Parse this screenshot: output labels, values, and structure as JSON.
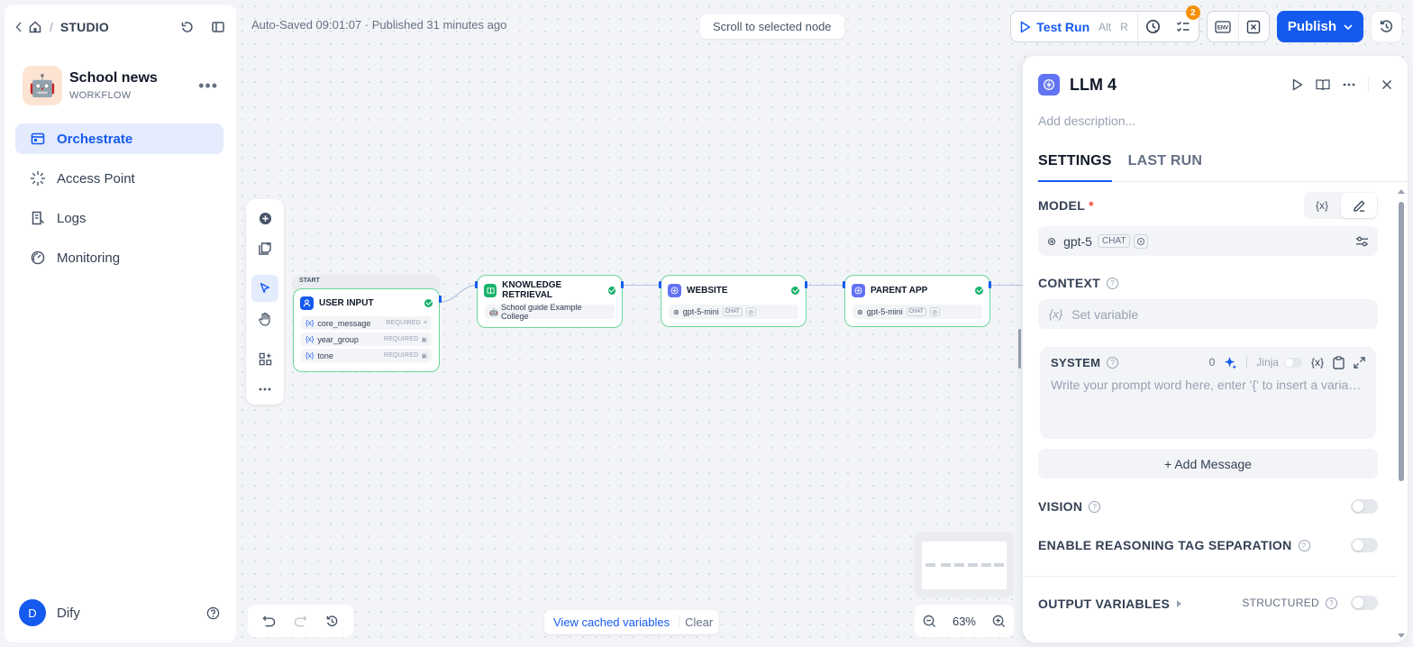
{
  "sidebar": {
    "breadcrumb": "STUDIO",
    "app": {
      "name": "School news",
      "kind": "WORKFLOW",
      "emoji": "🤖"
    },
    "nav": [
      {
        "label": "Orchestrate",
        "active": true,
        "icon": "orchestrate-icon"
      },
      {
        "label": "Access Point",
        "active": false,
        "icon": "access-point-icon"
      },
      {
        "label": "Logs",
        "active": false,
        "icon": "logs-icon"
      },
      {
        "label": "Monitoring",
        "active": false,
        "icon": "monitoring-icon"
      }
    ],
    "user": {
      "initial": "D",
      "name": "Dify"
    }
  },
  "header": {
    "autosave": "Auto-Saved 09:01:07 · Published 31 minutes ago",
    "scroll_to_node": "Scroll to selected node",
    "test_run": "Test Run",
    "test_run_kbd": [
      "Alt",
      "R"
    ],
    "checklist_count": "2",
    "env_label": "ENV",
    "publish": "Publish"
  },
  "nodes": {
    "start_tab": "START",
    "user_input": {
      "title": "USER INPUT",
      "vars": [
        {
          "name": "core_message",
          "req": "REQUIRED"
        },
        {
          "name": "year_group",
          "req": "REQUIRED"
        },
        {
          "name": "tone",
          "req": "REQUIRED"
        }
      ]
    },
    "knowledge": {
      "title": "KNOWLEDGE RETRIEVAL",
      "dataset": "School guide Example College"
    },
    "website": {
      "title": "WEBSITE",
      "model": "gpt-5-mini",
      "tag": "CHAT"
    },
    "parent_app": {
      "title": "PARENT APP",
      "model": "gpt-5-mini",
      "tag": "CHAT"
    }
  },
  "bottom": {
    "view_cached": "View cached variables",
    "clear": "Clear",
    "zoom": "63%"
  },
  "panel": {
    "title": "LLM 4",
    "description_placeholder": "Add description...",
    "tabs": [
      "SETTINGS",
      "LAST RUN"
    ],
    "model": {
      "label": "MODEL",
      "required": "*",
      "var_btn": "{x}",
      "name": "gpt-5",
      "tag": "CHAT"
    },
    "context": {
      "label": "CONTEXT",
      "placeholder": "Set variable",
      "x": "{x}"
    },
    "system": {
      "label": "SYSTEM",
      "count": "0",
      "jinja": "Jinja",
      "x": "{x}",
      "placeholder": "Write your prompt word here, enter '{' to insert a variable ..."
    },
    "add_message": "+ Add Message",
    "vision": "VISION",
    "reasoning": "ENABLE REASONING TAG SEPARATION",
    "output_variables": "OUTPUT VARIABLES",
    "structured": "STRUCTURED"
  }
}
